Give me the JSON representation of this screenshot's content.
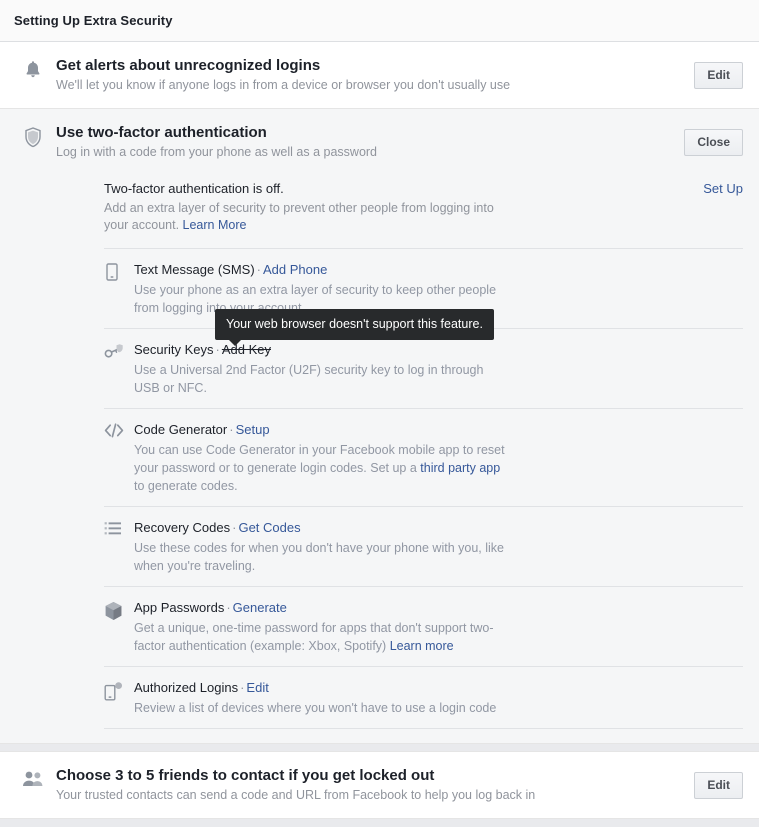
{
  "header": {
    "title": "Setting Up Extra Security"
  },
  "colors": {
    "link": "#365899",
    "text": "#1d2129",
    "muted": "#90949c",
    "page_bg": "#e9eaed",
    "panel_bg": "#ffffff",
    "expanded_bg": "#f5f6f7",
    "tooltip_bg": "#282a2c"
  },
  "sections": {
    "alerts": {
      "icon": "bell-icon",
      "title": "Get alerts about unrecognized logins",
      "subtitle": "We'll let you know if anyone logs in from a device or browser you don't usually use",
      "button": "Edit"
    },
    "two_factor": {
      "icon": "shield-icon",
      "title": "Use two-factor authentication",
      "subtitle": "Log in with a code from your phone as well as a password",
      "button": "Close",
      "status_text": "Two-factor authentication is off.",
      "status_link": "Set Up",
      "status_desc": "Add an extra layer of security to prevent other people from logging into your account.",
      "status_desc_link": "Learn More",
      "tooltip": "Your web browser doesn't support this feature.",
      "options": [
        {
          "icon": "mobile-phone-icon",
          "name": "Text Message (SMS)",
          "separator": "·",
          "action": "Add Phone",
          "action_disabled": false,
          "desc": "Use your phone as an extra layer of security to keep other people from logging into your account."
        },
        {
          "icon": "security-key-icon",
          "name": "Security Keys",
          "separator": "·",
          "action": "Add Key",
          "action_disabled": true,
          "desc": "Use a Universal 2nd Factor (U2F) security key to log in through USB or NFC."
        },
        {
          "icon": "code-brackets-icon",
          "name": "Code Generator",
          "separator": "·",
          "action": "Setup",
          "action_disabled": false,
          "desc_before": "You can use Code Generator in your Facebook mobile app to reset your password or to generate login codes. Set up a ",
          "desc_link": "third party app",
          "desc_after": " to generate codes."
        },
        {
          "icon": "list-icon",
          "name": "Recovery Codes",
          "separator": "·",
          "action": "Get Codes",
          "action_disabled": false,
          "desc": "Use these codes for when you don't have your phone with you, like when you're traveling."
        },
        {
          "icon": "cube-icon",
          "name": "App Passwords",
          "separator": "·",
          "action": "Generate",
          "action_disabled": false,
          "desc_before": "Get a unique, one-time password for apps that don't support two-factor authentication (example: Xbox, Spotify) ",
          "desc_link": "Learn more",
          "desc_after": ""
        },
        {
          "icon": "authorized-device-icon",
          "name": "Authorized Logins",
          "separator": "·",
          "action": "Edit",
          "action_disabled": false,
          "desc": "Review a list of devices where you won't have to use a login code"
        }
      ]
    },
    "trusted_contacts": {
      "icon": "friends-icon",
      "title": "Choose 3 to 5 friends to contact if you get locked out",
      "subtitle": "Your trusted contacts can send a code and URL from Facebook to help you log back in",
      "button": "Edit"
    }
  }
}
